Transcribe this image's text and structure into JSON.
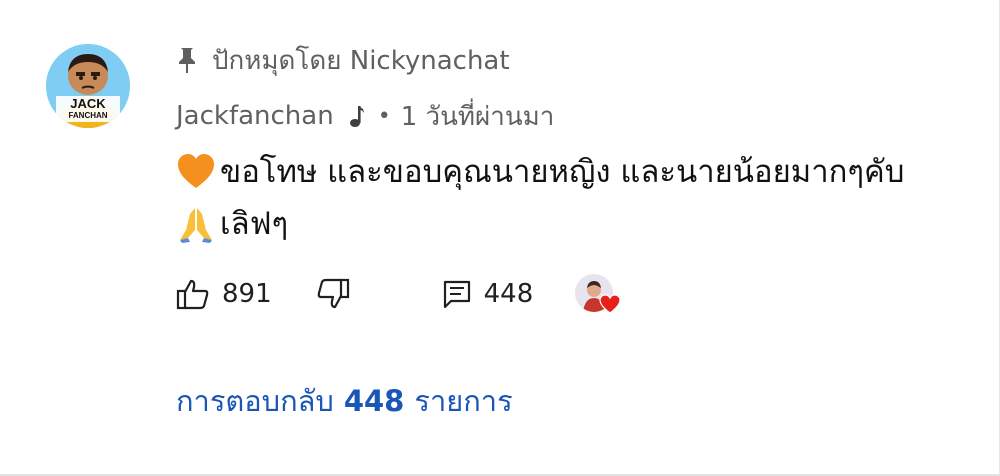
{
  "pinned": {
    "icon": "pin-icon",
    "text": "ปักหมุดโดย Nickynachat"
  },
  "comment": {
    "avatar_label_top": "JACK",
    "avatar_label_bottom": "FANCHAN",
    "author": "Jackfanchan",
    "author_badge_icon": "music-note-icon",
    "separator": "•",
    "time": "1 วันที่ผ่านมา",
    "line1_emoji": "orange-heart-emoji",
    "line1": "ขอโทษ และขอบคุณนายหญิง และนายน้อยมากๆคับ",
    "line2_emoji": "folded-hands-emoji",
    "line2": "เลิฟๆ"
  },
  "actions": {
    "like_icon": "thumb-up-icon",
    "like_count": "891",
    "dislike_icon": "thumb-down-icon",
    "reply_icon": "comment-icon",
    "reply_count": "448",
    "creator_heart_icon": "creator-heart-icon"
  },
  "replies": {
    "prefix": "การตอบกลับ",
    "count": "448",
    "suffix": "รายการ"
  },
  "colors": {
    "link_blue": "#1a56b8",
    "meta_gray": "#606060",
    "heart_red": "#e62117",
    "avatar_bg": "#7fcdf3"
  }
}
